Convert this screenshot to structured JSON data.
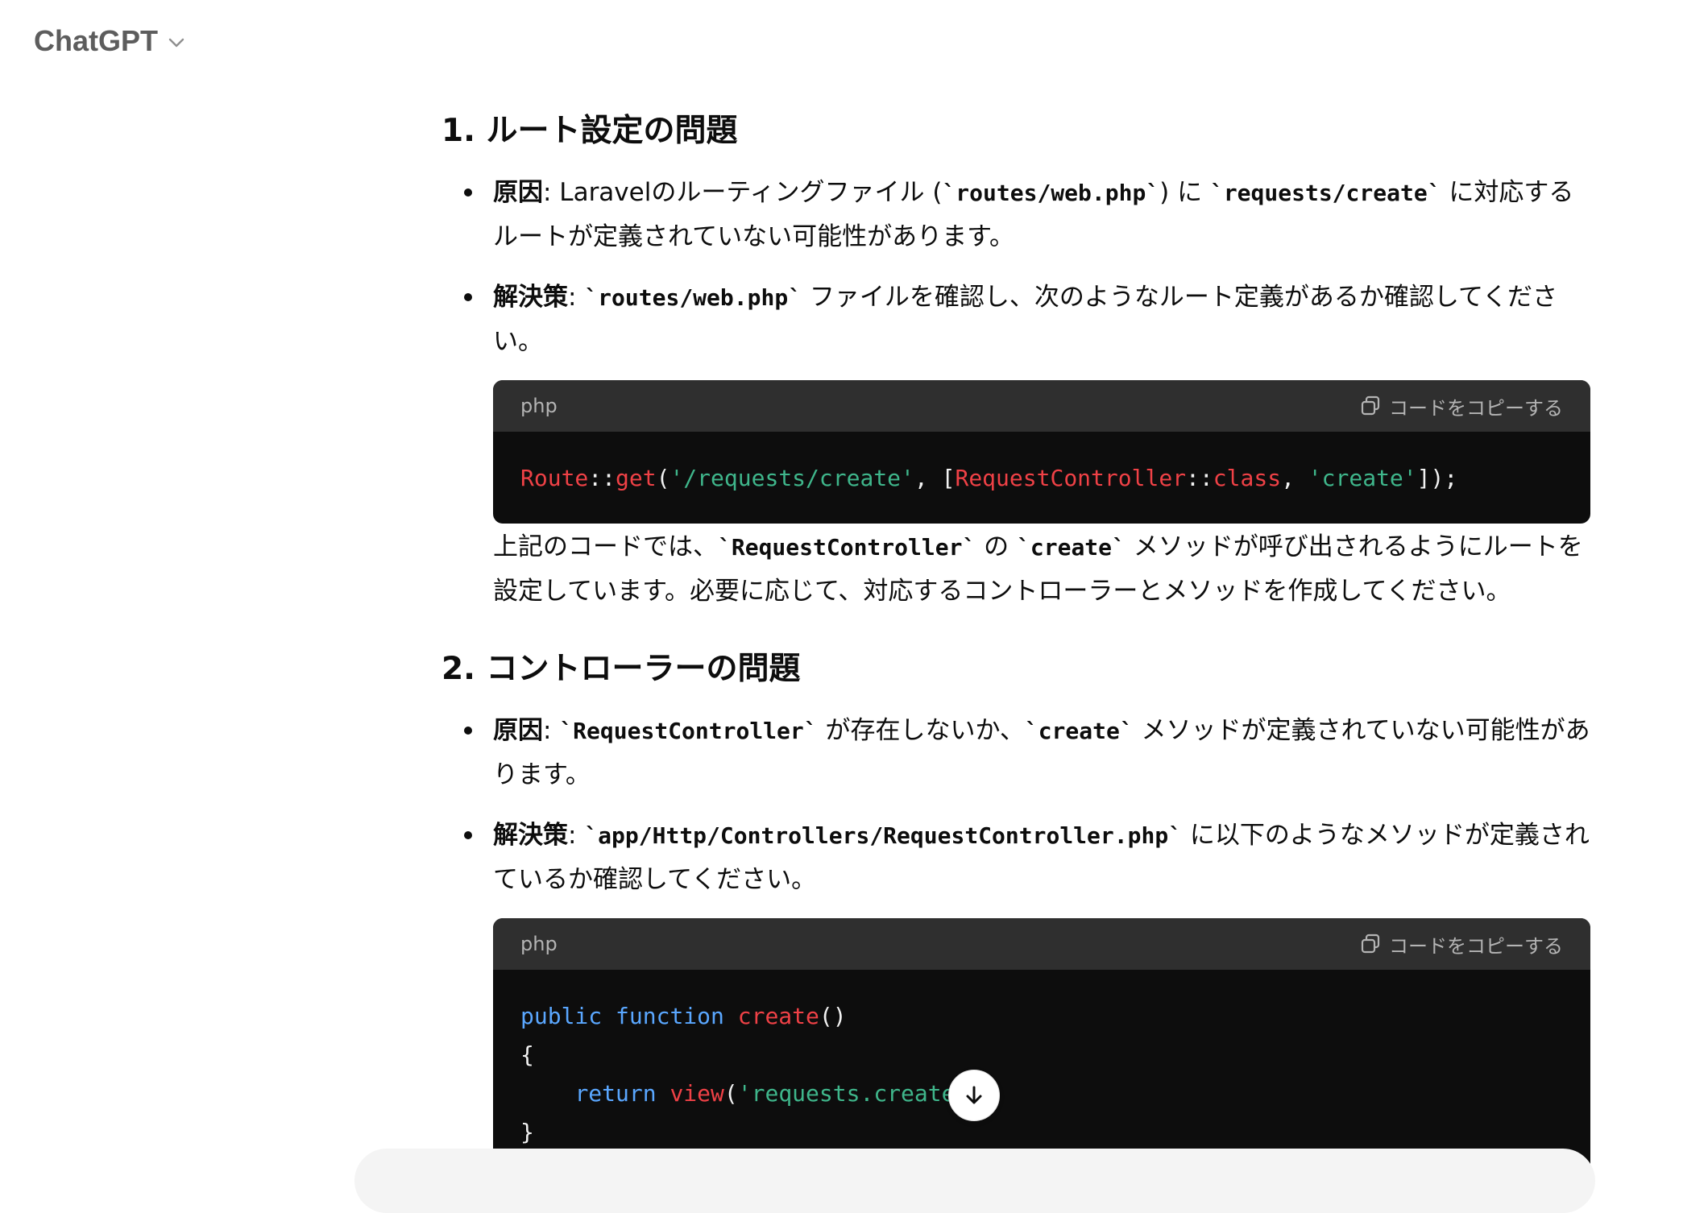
{
  "header": {
    "model_name": "ChatGPT"
  },
  "sections": {
    "s1": {
      "heading": "1. ルート設定の問題",
      "cause": {
        "label": "原因",
        "t1": ": Laravelのルーティングファイル (",
        "c1": "`routes/web.php`",
        "t2": ") に ",
        "c2": "`requests/create`",
        "t3": " に対応するルートが定義されていない可能性があります。"
      },
      "fix": {
        "label": "解決策",
        "t1": ": ",
        "c1": "`routes/web.php`",
        "t2": " ファイルを確認し、次のようなルート定義があるか確認してください。"
      },
      "code": {
        "lang": "php",
        "copy_label": "コードをコピーする",
        "tokens": {
          "route": "Route",
          "sep1": "::",
          "get": "get",
          "p1": "(",
          "path": "'/requests/create'",
          "comma1": ", ",
          "br1": "[",
          "controller": "RequestController",
          "sep2": "::",
          "class": "class",
          "comma2": ", ",
          "create": "'create'",
          "end": "]);"
        }
      },
      "after": {
        "t1": "上記のコードでは、",
        "c1": "`RequestController`",
        "t2": " の ",
        "c2": "`create`",
        "t3": " メソッドが呼び出されるようにルートを設定しています。必要に応じて、対応するコントローラーとメソッドを作成してください。"
      }
    },
    "s2": {
      "heading": "2. コントローラーの問題",
      "cause": {
        "label": "原因",
        "t1": ": ",
        "c1": "`RequestController`",
        "t2": " が存在しないか、",
        "c2": "`create`",
        "t3": " メソッドが定義されていない可能性があります。"
      },
      "fix": {
        "label": "解決策",
        "t1": ": ",
        "c1": "`app/Http/Controllers/RequestController.php`",
        "t2": " に以下のようなメソッドが定義されているか確認してください。"
      },
      "code": {
        "lang": "php",
        "copy_label": "コードをコピーする",
        "tokens": {
          "public": "public",
          "function": "function",
          "create": "create",
          "parens": "()",
          "open": "{",
          "ret": "return",
          "view": "view",
          "p1": "(",
          "str": "'requests.create",
          "close": "}"
        }
      }
    }
  },
  "colors": {
    "keyword": "#5aa7ff",
    "name": "#ef4146",
    "string": "#3fb68b"
  },
  "icons": {
    "chevron": "chevron-down-icon",
    "copy": "copy-icon",
    "scroll": "arrow-down-icon"
  }
}
